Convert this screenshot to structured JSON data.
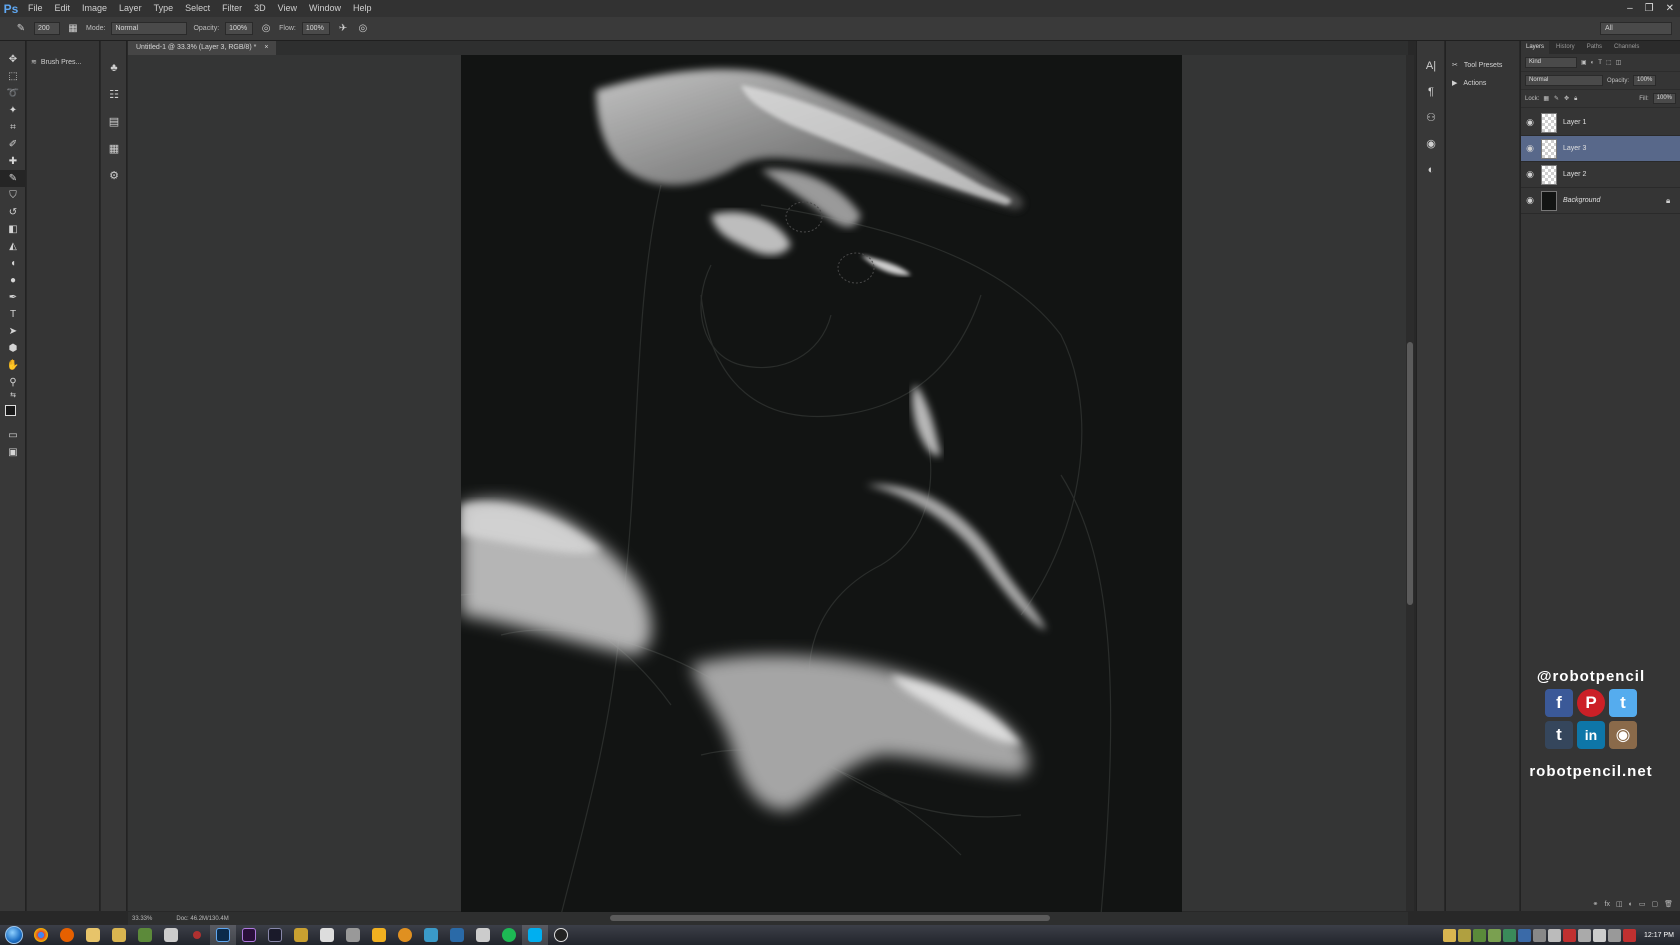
{
  "app": {
    "logo": "Ps",
    "menu": [
      "File",
      "Edit",
      "Image",
      "Layer",
      "Type",
      "Select",
      "Filter",
      "3D",
      "View",
      "Window",
      "Help"
    ],
    "window_controls": [
      "–",
      "❐",
      "✕"
    ]
  },
  "options_bar": {
    "brush_size": "200",
    "mode_label": "Mode:",
    "mode_value": "Normal",
    "opacity_label": "Opacity:",
    "opacity_value": "100%",
    "flow_label": "Flow:",
    "flow_value": "100%",
    "workspace": "All"
  },
  "brush_panel": {
    "label": "Brush Pres..."
  },
  "document": {
    "tab_title": "Untitled-1 @ 33.3% (Layer 3, RGB/8) *",
    "tab_close": "×",
    "zoom": "33.33%",
    "doc_size": "Doc: 46.2M/130.4M"
  },
  "right_mid_dock": {
    "items": [
      {
        "icon": "tool-presets-icon",
        "label": "Tool Presets"
      },
      {
        "icon": "actions-icon",
        "label": "Actions"
      }
    ]
  },
  "layers_panel": {
    "tabs": [
      "Layers",
      "History",
      "Paths",
      "Channels"
    ],
    "active_tab": "Layers",
    "filter_kind": "Kind",
    "blend_mode": "Normal",
    "opacity_label": "Opacity:",
    "opacity_value": "100%",
    "lock_label": "Lock:",
    "fill_label": "Fill:",
    "fill_value": "100%",
    "layers": [
      {
        "name": "Layer 1",
        "visible": true,
        "selected": false,
        "locked": false,
        "thumb": "transparent"
      },
      {
        "name": "Layer 3",
        "visible": true,
        "selected": true,
        "locked": false,
        "thumb": "transparent"
      },
      {
        "name": "Layer 2",
        "visible": true,
        "selected": false,
        "locked": false,
        "thumb": "transparent"
      },
      {
        "name": "Background",
        "visible": true,
        "selected": false,
        "locked": true,
        "thumb": "dark"
      }
    ]
  },
  "social": {
    "handle": "@robotpencil",
    "site": "robotpencil.net",
    "icons": [
      {
        "name": "facebook-icon",
        "glyph": "f",
        "color": "#3b5998"
      },
      {
        "name": "pinterest-icon",
        "glyph": "P",
        "color": "#cb2027"
      },
      {
        "name": "twitter-icon",
        "glyph": "t",
        "color": "#55acee"
      },
      {
        "name": "tumblr-icon",
        "glyph": "t",
        "color": "#35465c"
      },
      {
        "name": "linkedin-icon",
        "glyph": "in",
        "color": "#0e76a8"
      },
      {
        "name": "instagram-icon",
        "glyph": "◉",
        "color": "#8a6a4a"
      }
    ]
  },
  "taskbar": {
    "clock": "12:17 PM"
  }
}
